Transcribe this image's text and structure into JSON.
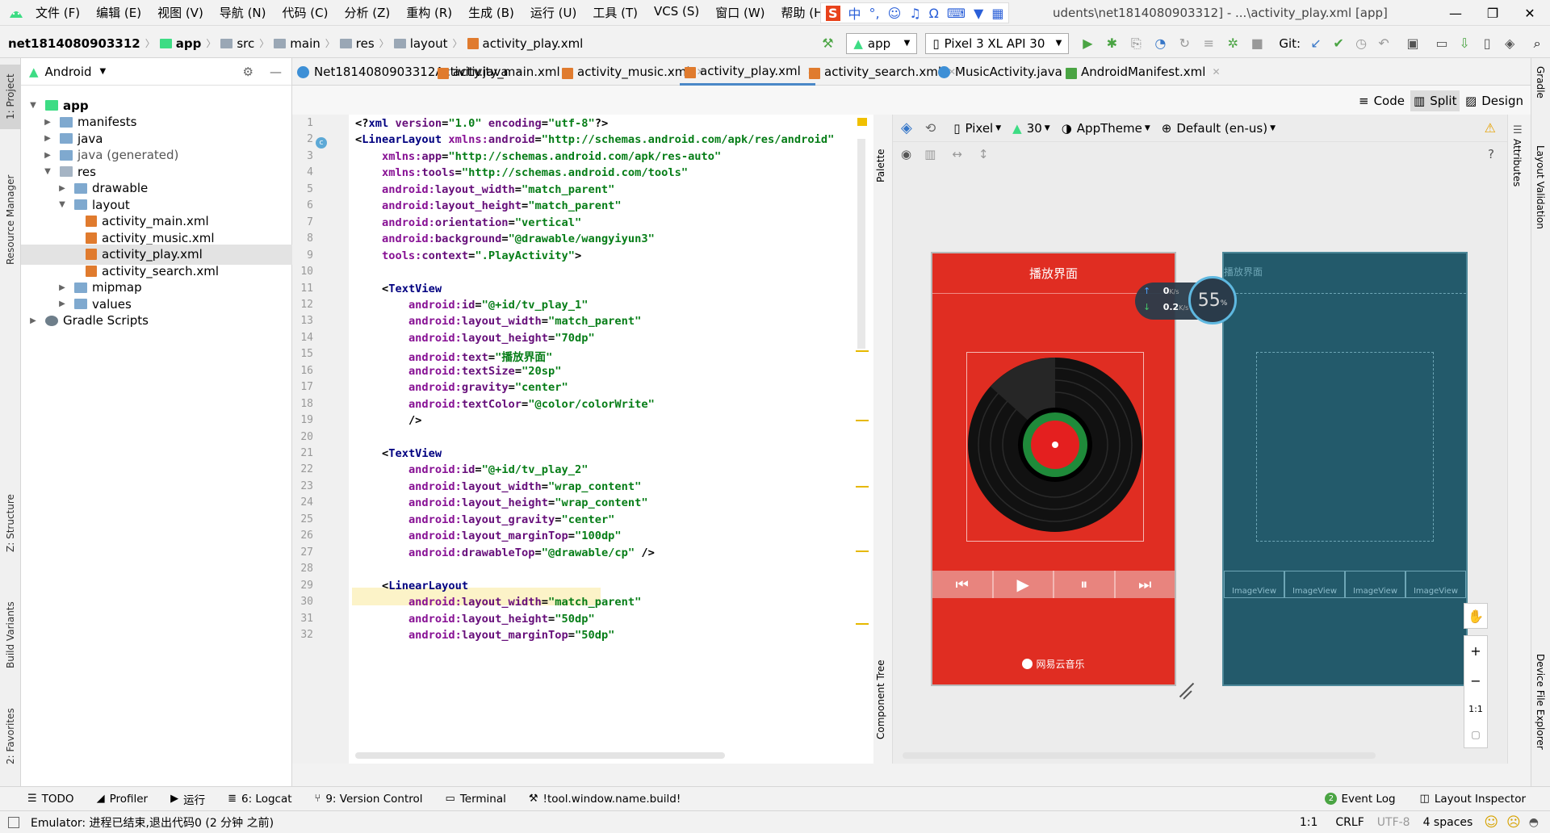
{
  "menubar": {
    "items": [
      "文件 (F)",
      "编辑 (E)",
      "视图 (V)",
      "导航 (N)",
      "代码 (C)",
      "分析 (Z)",
      "重构 (R)",
      "生成 (B)",
      "运行 (U)",
      "工具 (T)",
      "VCS (S)",
      "窗口 (W)",
      "帮助 (H)"
    ],
    "title_prefix": "net18140",
    "title_suffix": "udents\\net1814080903312] - ...\\activity_play.xml [app]",
    "ime_label": "中"
  },
  "toolbar": {
    "breadcrumbs": [
      "net1814080903312",
      "app",
      "src",
      "main",
      "res",
      "layout",
      "activity_play.xml"
    ],
    "run_config": "app",
    "device": "Pixel 3 XL API 30",
    "git_label": "Git:"
  },
  "project_panel": {
    "view_mode": "Android",
    "tree": [
      {
        "label": "app",
        "depth": 0,
        "expanded": true,
        "icon": "folder",
        "bold": true
      },
      {
        "label": "manifests",
        "depth": 1,
        "expanded": false,
        "icon": "folder"
      },
      {
        "label": "java",
        "depth": 1,
        "expanded": false,
        "icon": "folder"
      },
      {
        "label": "java (generated)",
        "depth": 1,
        "expanded": false,
        "icon": "folder"
      },
      {
        "label": "res",
        "depth": 1,
        "expanded": true,
        "icon": "folder"
      },
      {
        "label": "drawable",
        "depth": 2,
        "expanded": false,
        "icon": "folder"
      },
      {
        "label": "layout",
        "depth": 2,
        "expanded": true,
        "icon": "folder"
      },
      {
        "label": "activity_main.xml",
        "depth": 3,
        "icon": "xml"
      },
      {
        "label": "activity_music.xml",
        "depth": 3,
        "icon": "xml"
      },
      {
        "label": "activity_play.xml",
        "depth": 3,
        "icon": "xml",
        "selected": true
      },
      {
        "label": "activity_search.xml",
        "depth": 3,
        "icon": "xml"
      },
      {
        "label": "mipmap",
        "depth": 2,
        "expanded": false,
        "icon": "folder"
      },
      {
        "label": "values",
        "depth": 2,
        "expanded": false,
        "icon": "folder"
      },
      {
        "label": "Gradle Scripts",
        "depth": 0,
        "expanded": false,
        "icon": "gradle"
      }
    ]
  },
  "left_tool_tabs": [
    "1: Project",
    "Resource Manager",
    "Z: Structure",
    "Build Variants",
    "2: Favorites"
  ],
  "right_tool_tabs": [
    "Gradle",
    "Layout Validation",
    "Device File Explorer"
  ],
  "editor_tabs": [
    {
      "label": "Net1814080903312Activity.java",
      "type": "java"
    },
    {
      "label": "activity_main.xml",
      "type": "xml"
    },
    {
      "label": "activity_music.xml",
      "type": "xml"
    },
    {
      "label": "activity_play.xml",
      "type": "xml",
      "active": true
    },
    {
      "label": "activity_search.xml",
      "type": "xml"
    },
    {
      "label": "MusicActivity.java",
      "type": "java"
    },
    {
      "label": "AndroidManifest.xml",
      "type": "manifest"
    }
  ],
  "view_modes": {
    "code": "Code",
    "split": "Split",
    "design": "Design"
  },
  "design_toolbar": {
    "device": "Pixel",
    "api": "30",
    "theme": "AppTheme",
    "locale": "Default (en-us)"
  },
  "side_labels": {
    "palette": "Palette",
    "component_tree": "Component Tree",
    "attributes": "Attributes"
  },
  "code_lines": [
    {
      "n": 1,
      "indent": 0,
      "parts": [
        [
          "pu",
          "<?"
        ],
        [
          "tg",
          "xml "
        ],
        [
          "at",
          "version"
        ],
        [
          "pu",
          "="
        ],
        [
          "vl",
          "\"1.0\" "
        ],
        [
          "at",
          "encoding"
        ],
        [
          "pu",
          "="
        ],
        [
          "vl",
          "\"utf-8\""
        ],
        [
          "pu",
          "?>"
        ]
      ]
    },
    {
      "n": 2,
      "indent": 0,
      "parts": [
        [
          "pu",
          "<"
        ],
        [
          "tg",
          "LinearLayout "
        ],
        [
          "nsp",
          "xmlns:"
        ],
        [
          "at",
          "android"
        ],
        [
          "pu",
          "="
        ],
        [
          "vl",
          "\"http://schemas.android.com/apk/res/android\""
        ]
      ]
    },
    {
      "n": 3,
      "indent": 4,
      "parts": [
        [
          "nsp",
          "xmlns:"
        ],
        [
          "at",
          "app"
        ],
        [
          "pu",
          "="
        ],
        [
          "vl",
          "\"http://schemas.android.com/apk/res-auto\""
        ]
      ]
    },
    {
      "n": 4,
      "indent": 4,
      "parts": [
        [
          "nsp",
          "xmlns:"
        ],
        [
          "at",
          "tools"
        ],
        [
          "pu",
          "="
        ],
        [
          "vl",
          "\"http://schemas.android.com/tools\""
        ]
      ]
    },
    {
      "n": 5,
      "indent": 4,
      "parts": [
        [
          "nsp",
          "android:"
        ],
        [
          "at",
          "layout_width"
        ],
        [
          "pu",
          "="
        ],
        [
          "vl",
          "\"match_parent\""
        ]
      ]
    },
    {
      "n": 6,
      "indent": 4,
      "parts": [
        [
          "nsp",
          "android:"
        ],
        [
          "at",
          "layout_height"
        ],
        [
          "pu",
          "="
        ],
        [
          "vl",
          "\"match_parent\""
        ]
      ]
    },
    {
      "n": 7,
      "indent": 4,
      "parts": [
        [
          "nsp",
          "android:"
        ],
        [
          "at",
          "orientation"
        ],
        [
          "pu",
          "="
        ],
        [
          "vl",
          "\"vertical\""
        ]
      ]
    },
    {
      "n": 8,
      "indent": 4,
      "parts": [
        [
          "nsp",
          "android:"
        ],
        [
          "at",
          "background"
        ],
        [
          "pu",
          "="
        ],
        [
          "vl",
          "\"@drawable/wangyiyun3\""
        ]
      ]
    },
    {
      "n": 9,
      "indent": 4,
      "parts": [
        [
          "nsp",
          "tools:"
        ],
        [
          "at",
          "context"
        ],
        [
          "pu",
          "="
        ],
        [
          "vl",
          "\".PlayActivity\""
        ],
        [
          "pu",
          ">"
        ]
      ]
    },
    {
      "n": 10,
      "indent": 0,
      "parts": []
    },
    {
      "n": 11,
      "indent": 4,
      "parts": [
        [
          "pu",
          "<"
        ],
        [
          "tg",
          "TextView"
        ]
      ]
    },
    {
      "n": 12,
      "indent": 8,
      "parts": [
        [
          "nsp",
          "android:"
        ],
        [
          "at",
          "id"
        ],
        [
          "pu",
          "="
        ],
        [
          "vl",
          "\"@+id/tv_play_1\""
        ]
      ]
    },
    {
      "n": 13,
      "indent": 8,
      "parts": [
        [
          "nsp",
          "android:"
        ],
        [
          "at",
          "layout_width"
        ],
        [
          "pu",
          "="
        ],
        [
          "vl",
          "\"match_parent\""
        ]
      ]
    },
    {
      "n": 14,
      "indent": 8,
      "parts": [
        [
          "nsp",
          "android:"
        ],
        [
          "at",
          "layout_height"
        ],
        [
          "pu",
          "="
        ],
        [
          "vl",
          "\"70dp\""
        ]
      ]
    },
    {
      "n": 15,
      "indent": 8,
      "parts": [
        [
          "nsp",
          "android:"
        ],
        [
          "at",
          "text"
        ],
        [
          "pu",
          "="
        ],
        [
          "vl",
          "\"播放界面\""
        ]
      ]
    },
    {
      "n": 16,
      "indent": 8,
      "parts": [
        [
          "nsp",
          "android:"
        ],
        [
          "at",
          "textSize"
        ],
        [
          "pu",
          "="
        ],
        [
          "vl",
          "\"20sp\""
        ]
      ]
    },
    {
      "n": 17,
      "indent": 8,
      "parts": [
        [
          "nsp",
          "android:"
        ],
        [
          "at",
          "gravity"
        ],
        [
          "pu",
          "="
        ],
        [
          "vl",
          "\"center\""
        ]
      ]
    },
    {
      "n": 18,
      "indent": 8,
      "parts": [
        [
          "nsp",
          "android:"
        ],
        [
          "at",
          "textColor"
        ],
        [
          "pu",
          "="
        ],
        [
          "vl",
          "\"@color/colorWrite\""
        ]
      ]
    },
    {
      "n": 19,
      "indent": 8,
      "parts": [
        [
          "pu",
          "/>"
        ]
      ]
    },
    {
      "n": 20,
      "indent": 0,
      "parts": []
    },
    {
      "n": 21,
      "indent": 4,
      "parts": [
        [
          "pu",
          "<"
        ],
        [
          "tg",
          "TextView"
        ]
      ]
    },
    {
      "n": 22,
      "indent": 8,
      "parts": [
        [
          "nsp",
          "android:"
        ],
        [
          "at",
          "id"
        ],
        [
          "pu",
          "="
        ],
        [
          "vl",
          "\"@+id/tv_play_2\""
        ]
      ]
    },
    {
      "n": 23,
      "indent": 8,
      "parts": [
        [
          "nsp",
          "android:"
        ],
        [
          "at",
          "layout_width"
        ],
        [
          "pu",
          "="
        ],
        [
          "vl",
          "\"wrap_content\""
        ]
      ]
    },
    {
      "n": 24,
      "indent": 8,
      "parts": [
        [
          "nsp",
          "android:"
        ],
        [
          "at",
          "layout_height"
        ],
        [
          "pu",
          "="
        ],
        [
          "vl",
          "\"wrap_content\""
        ]
      ]
    },
    {
      "n": 25,
      "indent": 8,
      "parts": [
        [
          "nsp",
          "android:"
        ],
        [
          "at",
          "layout_gravity"
        ],
        [
          "pu",
          "="
        ],
        [
          "vl",
          "\"center\""
        ]
      ]
    },
    {
      "n": 26,
      "indent": 8,
      "parts": [
        [
          "nsp",
          "android:"
        ],
        [
          "at",
          "layout_marginTop"
        ],
        [
          "pu",
          "="
        ],
        [
          "vl",
          "\"100dp\""
        ]
      ]
    },
    {
      "n": 27,
      "indent": 8,
      "parts": [
        [
          "nsp",
          "android:"
        ],
        [
          "at",
          "drawableTop"
        ],
        [
          "pu",
          "="
        ],
        [
          "vl",
          "\"@drawable/cp\""
        ],
        [
          "pu",
          " />"
        ]
      ]
    },
    {
      "n": 28,
      "indent": 0,
      "parts": []
    },
    {
      "n": 29,
      "indent": 4,
      "parts": [
        [
          "pu",
          "<"
        ],
        [
          "tg",
          "LinearLayout"
        ]
      ]
    },
    {
      "n": 30,
      "indent": 8,
      "parts": [
        [
          "nsp",
          "android:"
        ],
        [
          "at",
          "layout_width"
        ],
        [
          "pu",
          "="
        ],
        [
          "vl",
          "\"match_parent\""
        ]
      ]
    },
    {
      "n": 31,
      "indent": 8,
      "parts": [
        [
          "nsp",
          "android:"
        ],
        [
          "at",
          "layout_height"
        ],
        [
          "pu",
          "="
        ],
        [
          "vl",
          "\"50dp\""
        ]
      ]
    },
    {
      "n": 32,
      "indent": 8,
      "parts": [
        [
          "nsp",
          "android:"
        ],
        [
          "at",
          "layout_marginTop"
        ],
        [
          "pu",
          "="
        ],
        [
          "vl",
          "\"50dp\""
        ]
      ]
    }
  ],
  "phone_preview": {
    "title": "播放界面",
    "footer_brand": "网易云音乐",
    "colors": {
      "background": "#e02d22",
      "record": "#111111",
      "label_green": "#1f8a3a",
      "label_red": "#e41f1f"
    }
  },
  "blueprint_preview": {
    "title": "播放界面",
    "image_view_label": "ImageView"
  },
  "net_widget": {
    "upload": "0",
    "download": "0.2",
    "unit": "K/s",
    "percent": "55",
    "percent_unit": "%"
  },
  "zoom_controls": {
    "fit_label": "1:1"
  },
  "bottom_tools": [
    {
      "icon": "todo-icon",
      "label": "TODO"
    },
    {
      "icon": "profiler-icon",
      "label": "Profiler"
    },
    {
      "icon": "run-icon",
      "label": "运行"
    },
    {
      "icon": "logcat-icon",
      "label": "6: Logcat"
    },
    {
      "icon": "vcs-icon",
      "label": "9: Version Control"
    },
    {
      "icon": "terminal-icon",
      "label": "Terminal"
    },
    {
      "icon": "build-icon",
      "label": "!tool.window.name.build!"
    }
  ],
  "bottom_right_tools": [
    {
      "icon": "event-log-icon",
      "label": "Event Log",
      "badge": "2"
    },
    {
      "icon": "layout-inspector-icon",
      "label": "Layout Inspector"
    }
  ],
  "statusbar": {
    "message": "Emulator: 进程已结束,退出代码0 (2 分钟 之前)",
    "position": "1:1",
    "line_sep": "CRLF",
    "encoding": "UTF-8",
    "indent": "4 spaces"
  }
}
